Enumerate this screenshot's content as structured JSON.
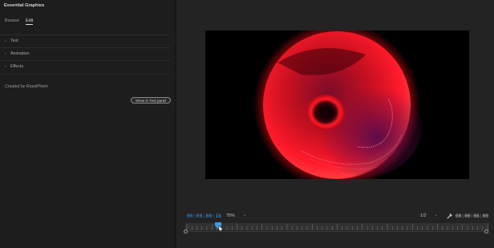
{
  "panel": {
    "title": "Essential Graphics",
    "menu_icon": "hamburger-menu-icon",
    "tabs": [
      {
        "label": "Browse",
        "active": false
      },
      {
        "label": "Edit",
        "active": true
      }
    ],
    "sections": [
      {
        "label": "Text",
        "icon": "chevron-right-icon"
      },
      {
        "label": "Animation",
        "icon": "chevron-right-icon"
      },
      {
        "label": "Effects",
        "icon": "chevron-right-icon"
      }
    ],
    "credit": "Created by RoyalPixels",
    "show_button": "Show in Text panel"
  },
  "monitor": {
    "current_timecode": "00:00:00:16",
    "zoom": "75%",
    "resolution": "1/2",
    "duration": "00:00:06:00",
    "playhead_fraction": 0.109,
    "colors": {
      "timecode_blue": "#3d9be9",
      "sphere_red": "#ff1a2a",
      "sphere_purple": "#6a0f4a"
    }
  }
}
